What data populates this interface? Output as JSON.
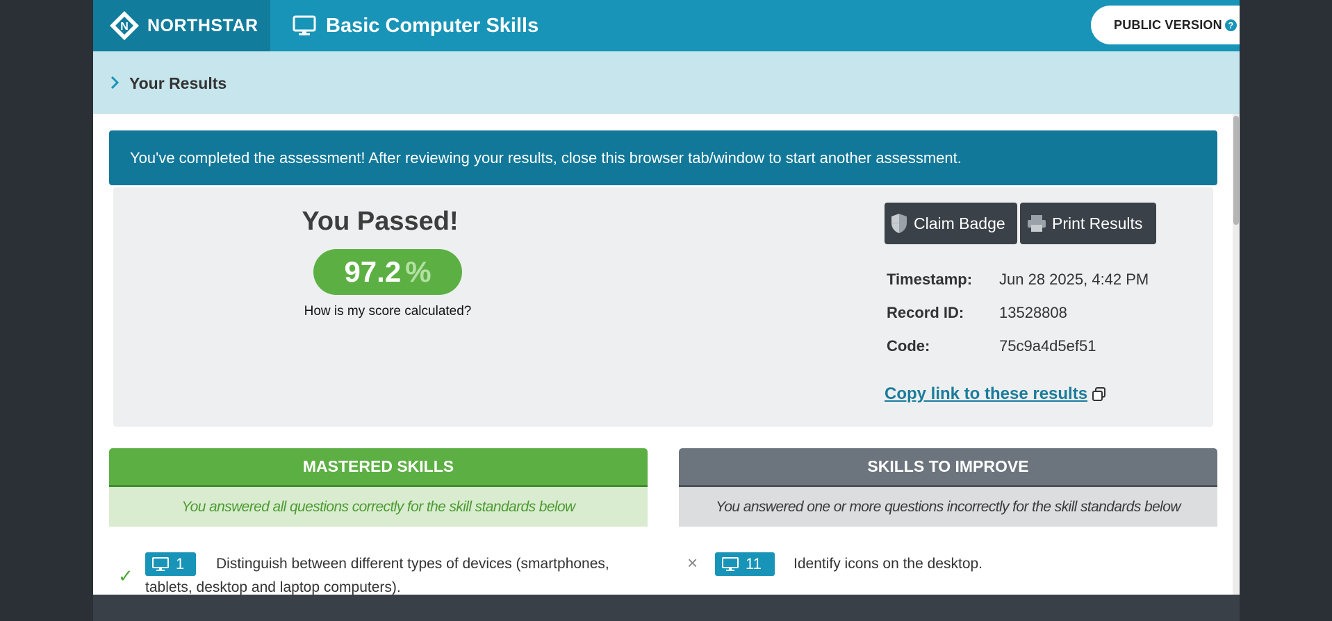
{
  "header": {
    "brand": "NORTHSTAR",
    "course_title": "Basic Computer Skills",
    "public_version_label": "PUBLIC VERSION",
    "help_glyph": "?"
  },
  "results_bar": {
    "label": "Your Results"
  },
  "banner": {
    "text": "You've completed the assessment! After reviewing your results, close this browser tab/window to start another assessment."
  },
  "result": {
    "heading": "You Passed!",
    "score": "97.2",
    "percent_sign": "%",
    "score_link": "How is my score calculated?"
  },
  "actions": {
    "claim_badge": "Claim Badge",
    "print_results": "Print Results"
  },
  "meta": {
    "timestamp_label": "Timestamp:",
    "timestamp_value": "Jun 28 2025, 4:42 PM",
    "record_label": "Record ID:",
    "record_value": "13528808",
    "code_label": "Code:",
    "code_value": "75c9a4d5ef51"
  },
  "copy_link": "Copy link to these results",
  "mastered": {
    "heading": "MASTERED SKILLS",
    "subtitle": "You answered all questions correctly for the skill standards below",
    "items": [
      {
        "number": "1",
        "text": "Distinguish between different types of devices (smartphones, tablets, desktop and laptop computers)."
      }
    ]
  },
  "improve": {
    "heading": "SKILLS TO IMPROVE",
    "subtitle": "You answered one or more questions incorrectly for the skill standards below",
    "items": [
      {
        "number": "11",
        "text": "Identify icons on the desktop."
      }
    ]
  },
  "colors": {
    "header_blue": "#1894b8",
    "brand_dark": "#117c9c",
    "results_bar": "#c6e5ec",
    "banner": "#12789a",
    "pass_green": "#5cb043",
    "improve_gray": "#6c757d",
    "button_dark": "#3b4148"
  },
  "icons": [
    "northstar-logo-icon",
    "monitor-icon",
    "help-icon",
    "chevron-right-icon",
    "shield-icon",
    "printer-icon",
    "copy-icon",
    "check-icon",
    "close-icon"
  ]
}
